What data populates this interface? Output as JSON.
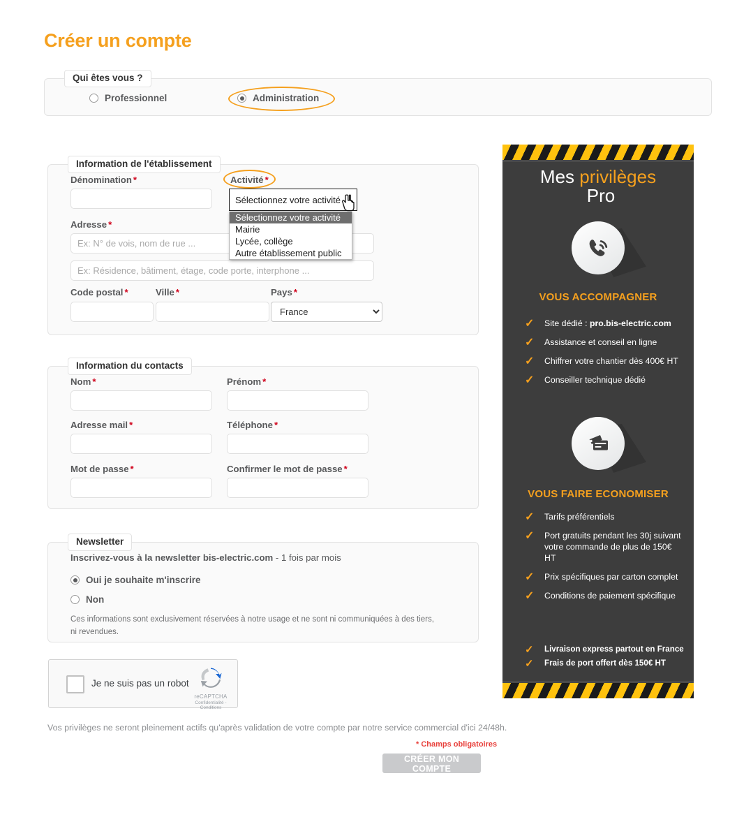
{
  "page": {
    "title": "Créer un compte"
  },
  "who": {
    "legend": "Qui êtes vous ?",
    "options": [
      {
        "label": "Professionnel",
        "checked": false
      },
      {
        "label": "Administration",
        "checked": true
      }
    ]
  },
  "establishment": {
    "legend": "Information de l'établissement",
    "denomination_label": "Dénomination",
    "denomination_value": "",
    "activity_label": "Activité",
    "activity_selected": "Sélectionnez votre activité",
    "activity_options": [
      "Sélectionnez votre activité",
      "Mairie",
      "Lycée, collège",
      "Autre établissement public"
    ],
    "address_label": "Adresse",
    "address1_placeholder": "Ex: N° de vois, nom de rue ...",
    "address1_value": "",
    "address2_placeholder": "Ex: Résidence, bâtiment, étage, code porte, interphone ...",
    "address2_value": "",
    "postal_label": "Code postal",
    "postal_value": "",
    "city_label": "Ville",
    "city_value": "",
    "country_label": "Pays",
    "country_selected": "France"
  },
  "contact": {
    "legend": "Information du contacts",
    "lastname_label": "Nom",
    "lastname_value": "",
    "firstname_label": "Prénom",
    "firstname_value": "",
    "email_label": "Adresse mail",
    "email_value": "",
    "phone_label": "Téléphone",
    "phone_value": "",
    "password_label": "Mot de passe",
    "password_value": "",
    "password_confirm_label": "Confirmer le mot de passe",
    "password_confirm_value": ""
  },
  "newsletter": {
    "legend": "Newsletter",
    "intro_bold": "Inscrivez-vous à la newsletter bis-electric.com",
    "intro_rest": " - 1 fois par mois",
    "options": [
      {
        "label": "Oui je souhaite m'inscrire",
        "checked": true
      },
      {
        "label": "Non",
        "checked": false
      }
    ],
    "note": "Ces informations sont exclusivement réservées à notre usage et ne sont ni communiquées à des tiers, ni revendues."
  },
  "recaptcha": {
    "label": "Je ne suis pas un robot",
    "brand": "reCAPTCHA",
    "links": "Confidentialité - Conditions"
  },
  "footer": {
    "note": "Vos privilèges ne seront pleinement actifs qu'après validation de votre compte par notre service commercial d'ici 24/48h.",
    "mandatory": "* Champs obligatoires",
    "submit": "CRÉER MON COMPTE"
  },
  "privileges": {
    "title_part1": "Mes ",
    "title_highlight": "privilèges",
    "title_line2": "Pro",
    "sections": [
      {
        "icon": "phone-icon",
        "title": "VOUS ACCOMPAGNER",
        "items": [
          {
            "prefix": "Site dédié : ",
            "strong": "pro.bis-electric.com"
          },
          {
            "prefix": "Assistance et conseil en ligne",
            "strong": ""
          },
          {
            "prefix": "Chiffrer votre chantier dès 400€ HT",
            "strong": ""
          },
          {
            "prefix": "Conseiller technique dédié",
            "strong": ""
          }
        ]
      },
      {
        "icon": "credit-card-icon",
        "title": "VOUS FAIRE ECONOMISER",
        "items": [
          {
            "prefix": "Tarifs préférentiels",
            "strong": ""
          },
          {
            "prefix": "Port gratuits pendant les 30j suivant votre commande de plus de 150€ HT",
            "strong": ""
          },
          {
            "prefix": "Prix spécifiques par carton complet",
            "strong": ""
          },
          {
            "prefix": "Conditions de paiement spécifique",
            "strong": ""
          }
        ]
      }
    ],
    "extra_items": [
      "Livraison express partout en France",
      "Frais de port offert dès 150€ HT"
    ]
  },
  "colors": {
    "accent_orange": "#f5a01e",
    "hazard_yellow": "#ffc20e",
    "panel_dark": "#3d3d3d",
    "required_red": "#d0021b"
  }
}
